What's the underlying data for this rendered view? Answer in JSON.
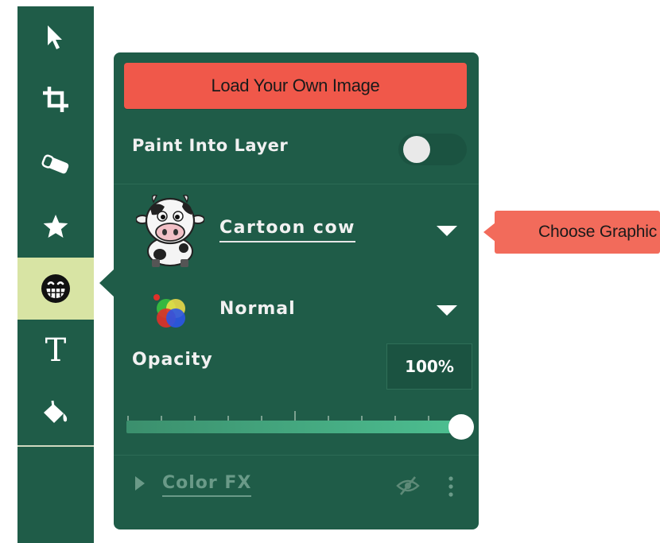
{
  "toolbar": {
    "tools": [
      {
        "name": "select-tool",
        "icon": "arrow-pointer-icon"
      },
      {
        "name": "crop-tool",
        "icon": "crop-icon"
      },
      {
        "name": "eraser-tool",
        "icon": "eraser-icon"
      },
      {
        "name": "star-tool",
        "icon": "star-icon"
      },
      {
        "name": "graphics-tool",
        "icon": "grinning-face-icon",
        "active": true
      },
      {
        "name": "text-tool",
        "icon": "text-icon",
        "letter": "T"
      },
      {
        "name": "fill-tool",
        "icon": "paint-bucket-icon"
      }
    ],
    "active_color": "#d8e4a4",
    "background": "#1f5c48"
  },
  "panel": {
    "load_button_label": "Load Your Own Image",
    "paint_into_layer_label": "Paint Into Layer",
    "paint_into_layer_on": false,
    "graphic_selected": "Cartoon cow",
    "blend_mode": "Normal",
    "opacity_label": "Opacity",
    "opacity_value": "100%",
    "opacity_level": 1.0,
    "color_fx_label": "Color FX",
    "background": "#1f5c48",
    "accent": "#f0584a"
  },
  "callout": {
    "text": "Choose Graphic",
    "color": "#f26b5b"
  }
}
